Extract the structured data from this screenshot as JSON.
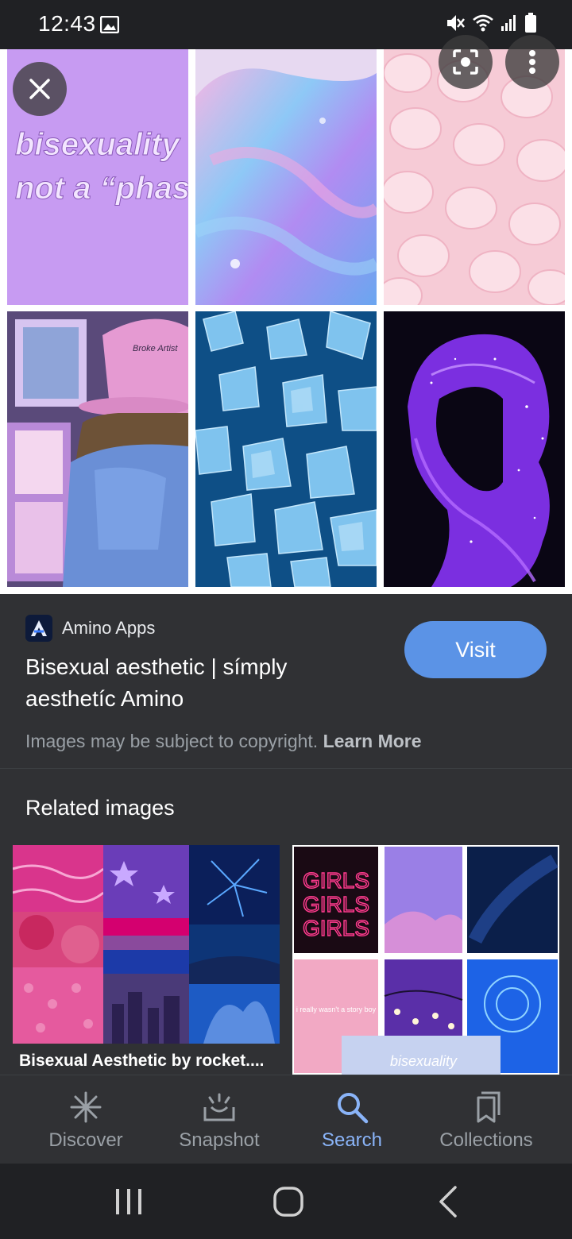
{
  "status": {
    "time": "12:43"
  },
  "info": {
    "source_name": "Amino Apps",
    "title": "Bisexual aesthetic | símply aesthetíc Amino",
    "visit_label": "Visit",
    "copyright_text": "Images may be subject to copyright. ",
    "learn_more": "Learn More"
  },
  "grid_text": {
    "tile1_line1": "bisexuality",
    "tile1_line2": "not a “phase”",
    "tile4_cap": "Broke Artist"
  },
  "related": {
    "heading": "Related images",
    "card1_caption": "Bisexual Aesthetic by rocket....",
    "card2_neon": [
      "GIRLS",
      "GIRLS",
      "GIRLS"
    ],
    "card2_small": "i really wasn't a story boy",
    "card2_bottom": "bisexuality"
  },
  "bottom_nav": {
    "items": [
      {
        "label": "Discover",
        "icon": "asterisk-icon"
      },
      {
        "label": "Snapshot",
        "icon": "snapshot-icon"
      },
      {
        "label": "Search",
        "icon": "search-icon"
      },
      {
        "label": "Collections",
        "icon": "bookmark-icon"
      }
    ],
    "active": "Search"
  },
  "colors": {
    "accent": "#8ab4f8",
    "visit_button": "#5b93e6",
    "panel": "#303134",
    "background": "#202124"
  }
}
